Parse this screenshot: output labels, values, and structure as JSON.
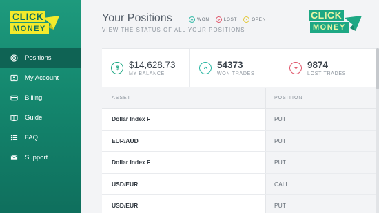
{
  "brand": {
    "line1": "CLICK",
    "line2": "MONEY"
  },
  "sidebar": {
    "items": [
      {
        "label": "Positions",
        "icon": "target-icon",
        "active": true
      },
      {
        "label": "My Account",
        "icon": "account-icon",
        "active": false
      },
      {
        "label": "Billing",
        "icon": "billing-icon",
        "active": false
      },
      {
        "label": "Guide",
        "icon": "book-icon",
        "active": false
      },
      {
        "label": "FAQ",
        "icon": "list-icon",
        "active": false
      },
      {
        "label": "Support",
        "icon": "mail-icon",
        "active": false
      }
    ]
  },
  "header": {
    "title": "Your Positions",
    "subtitle": "VIEW THE STATUS OF ALL YOUR POSITIONS",
    "legend": [
      {
        "label": "WON",
        "color": "#2ab7a3",
        "icon": "chevron-up-icon"
      },
      {
        "label": "LOST",
        "color": "#e0566b",
        "icon": "chevron-down-icon"
      },
      {
        "label": "OPEN",
        "color": "#e3c93c",
        "icon": "clock-icon"
      }
    ]
  },
  "stats": {
    "balance": {
      "value": "$14,628.73",
      "label": "MY BALANCE",
      "color": "#1ea884",
      "icon": "dollar-icon"
    },
    "won": {
      "value": "54373",
      "label": "WON TRADES",
      "color": "#2ab7a3",
      "icon": "chevron-up-icon"
    },
    "lost": {
      "value": "9874",
      "label": "LOST TRADES",
      "color": "#e0566b",
      "icon": "chevron-down-icon"
    }
  },
  "table": {
    "headers": {
      "asset": "ASSET",
      "position": "POSITION"
    },
    "rows": [
      {
        "asset": "Dollar Index F",
        "position": "PUT"
      },
      {
        "asset": "EUR/AUD",
        "position": "PUT"
      },
      {
        "asset": "Dollar Index F",
        "position": "PUT"
      },
      {
        "asset": "USD/EUR",
        "position": "CALL"
      },
      {
        "asset": "USD/EUR",
        "position": "PUT"
      }
    ]
  },
  "colors": {
    "sidebar_top": "#1e9a7d",
    "sidebar_bottom": "#0f6f5d",
    "logo_yellow": "#f3ea2c",
    "logo_green": "#1ea884"
  }
}
